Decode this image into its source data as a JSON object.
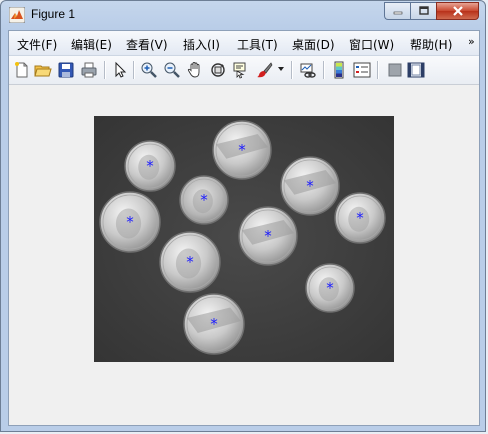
{
  "window": {
    "title": "Figure 1",
    "icon": "matlab-figure-icon"
  },
  "menu": [
    "文件(F)",
    "编辑(E)",
    "查看(V)",
    "插入(I)",
    "工具(T)",
    "桌面(D)",
    "窗口(W)",
    "帮助(H)"
  ],
  "menu_overflow": "»",
  "toolbar": [
    "new-figure-icon",
    "open-file-icon",
    "save-icon",
    "print-icon",
    "edit-plot-arrow-icon",
    "zoom-in-icon",
    "zoom-out-icon",
    "pan-hand-icon",
    "rotate-3d-icon",
    "data-cursor-icon",
    "brush-icon",
    "link-plot-icon",
    "colorbar-icon",
    "legend-icon",
    "hide-plot-tools-icon",
    "show-plot-tools-icon"
  ],
  "figure": {
    "content": "grayscale image of coins with blue centroid markers",
    "background": "#3a3a3a",
    "marker_color": "#1a1aff",
    "marker": "*",
    "coin_count": 10
  }
}
